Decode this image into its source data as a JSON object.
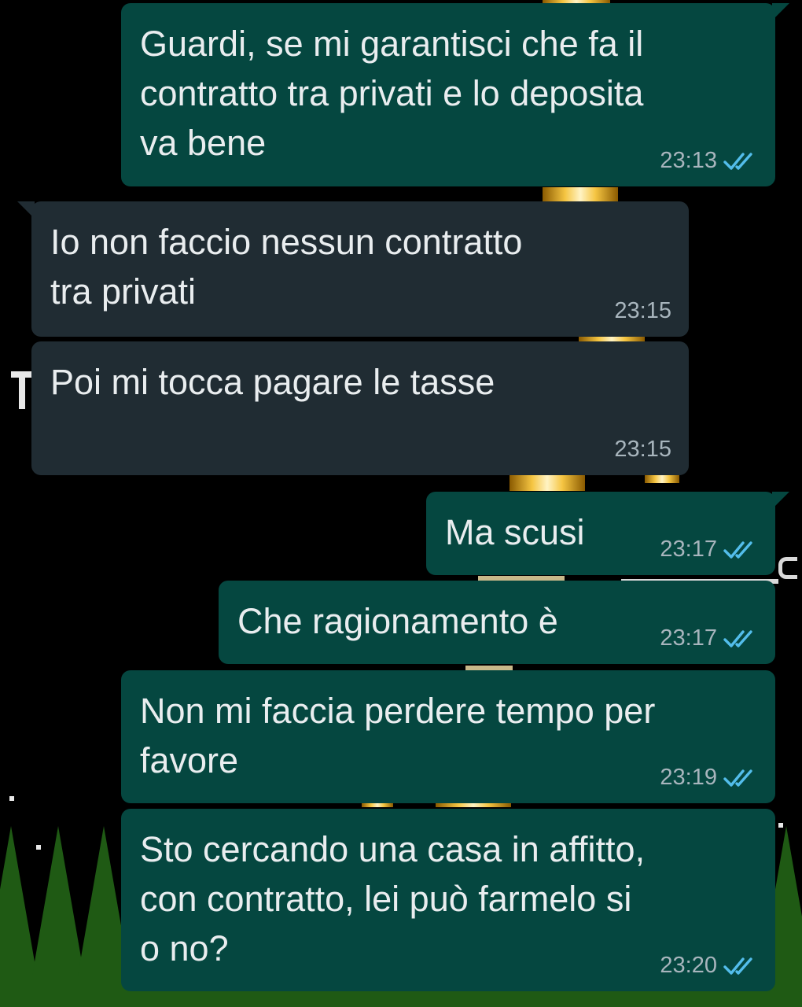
{
  "colors": {
    "outgoing_bubble": "#054740",
    "incoming_bubble": "#202c33",
    "text": "#e9edef",
    "timestamp": "#a8b5bd",
    "read_ticks": "#53bdeb"
  },
  "icons": {
    "read_receipt": "double-check-icon"
  },
  "messages": [
    {
      "direction": "outgoing",
      "text": "Guardi, se mi garantisci che fa il\ncontratto tra privati e lo deposita\nva bene",
      "time": "23:13",
      "read": true
    },
    {
      "direction": "incoming",
      "text": "Io non faccio nessun contratto\ntra privati",
      "time": "23:15"
    },
    {
      "direction": "incoming",
      "text": "Poi mi tocca pagare le tasse",
      "time": "23:15"
    },
    {
      "direction": "outgoing",
      "text": "Ma scusi",
      "time": "23:17",
      "read": true
    },
    {
      "direction": "outgoing",
      "text": "Che ragionamento è",
      "time": "23:17",
      "read": true
    },
    {
      "direction": "outgoing",
      "text": "Non mi faccia perdere tempo per\nfavore",
      "time": "23:19",
      "read": true
    },
    {
      "direction": "outgoing",
      "text": "Sto cercando una casa in affitto,\ncon contratto, lei può farmelo si\no no?",
      "time": "23:20",
      "read": true
    }
  ]
}
